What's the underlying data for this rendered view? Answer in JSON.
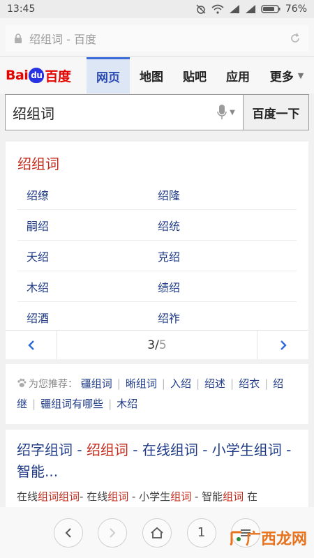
{
  "status": {
    "time": "13:45",
    "battery": "76%"
  },
  "browser": {
    "url": "绍组词 - 百度"
  },
  "baidu": {
    "logo": {
      "bai": "Bai",
      "du": "du",
      "cn": "百度"
    },
    "tabs": [
      {
        "label": "网页",
        "active": true
      },
      {
        "label": "地图",
        "active": false
      },
      {
        "label": "贴吧",
        "active": false
      },
      {
        "label": "应用",
        "active": false
      },
      {
        "label": "更多",
        "active": false
      }
    ],
    "search": {
      "value": "绍组词",
      "button": "百度一下"
    }
  },
  "result_card": {
    "title": "绍组词",
    "rows": [
      [
        "绍缭",
        "绍隆"
      ],
      [
        "嗣绍",
        "绍统"
      ],
      [
        "夭绍",
        "克绍"
      ],
      [
        "木绍",
        "绩绍"
      ],
      [
        "绍酒",
        "绍祚"
      ]
    ],
    "pager": {
      "current": "3",
      "sep": "/",
      "total": "5"
    }
  },
  "recommend": {
    "label": "为您推荐：",
    "items": [
      "疆组词",
      "晰组词",
      "入绍",
      "绍述",
      "绍衣",
      "绍继",
      "疆组词有哪些",
      "木绍"
    ]
  },
  "result2": {
    "title_parts": [
      {
        "t": "绍字组词 - ",
        "hl": false
      },
      {
        "t": "绍组词",
        "hl": true
      },
      {
        "t": " - 在线组词 - 小学生组词 - 智能...",
        "hl": false
      }
    ],
    "abstract_parts": [
      {
        "t": "在线",
        "hl": false
      },
      {
        "t": "组词组词",
        "hl": true
      },
      {
        "t": "- 在线",
        "hl": false
      },
      {
        "t": "组词",
        "hl": true
      },
      {
        "t": " - 小学生",
        "hl": false
      },
      {
        "t": "组词",
        "hl": true
      },
      {
        "t": " - 智能",
        "hl": false
      },
      {
        "t": "组词",
        "hl": true
      },
      {
        "t": " 在",
        "hl": false
      }
    ]
  },
  "toolbar": {
    "tab_count": "1"
  },
  "watermark": {
    "text": "广西龙网"
  },
  "colors": {
    "accent_blue": "#2b4ab2",
    "highlight_red": "#c3281a",
    "link_blue": "#203c88"
  }
}
